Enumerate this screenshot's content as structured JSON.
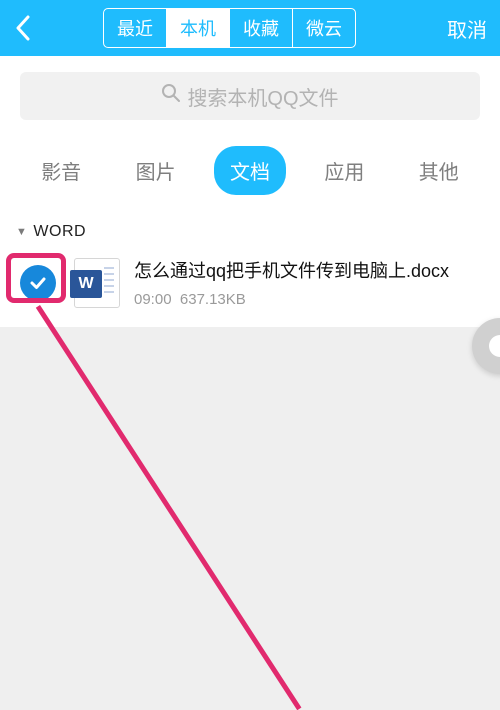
{
  "header": {
    "segments": [
      "最近",
      "本机",
      "收藏",
      "微云"
    ],
    "activeIndex": 1,
    "cancel": "取消"
  },
  "search": {
    "placeholder": "搜索本机QQ文件"
  },
  "tabs": {
    "items": [
      "影音",
      "图片",
      "文档",
      "应用",
      "其他"
    ],
    "activeIndex": 2
  },
  "section": {
    "title": "WORD"
  },
  "file": {
    "name": "怎么通过qq把手机文件传到电脑上.docx",
    "time": "09:00",
    "size": "637.13KB",
    "iconLetter": "W",
    "checked": true
  }
}
